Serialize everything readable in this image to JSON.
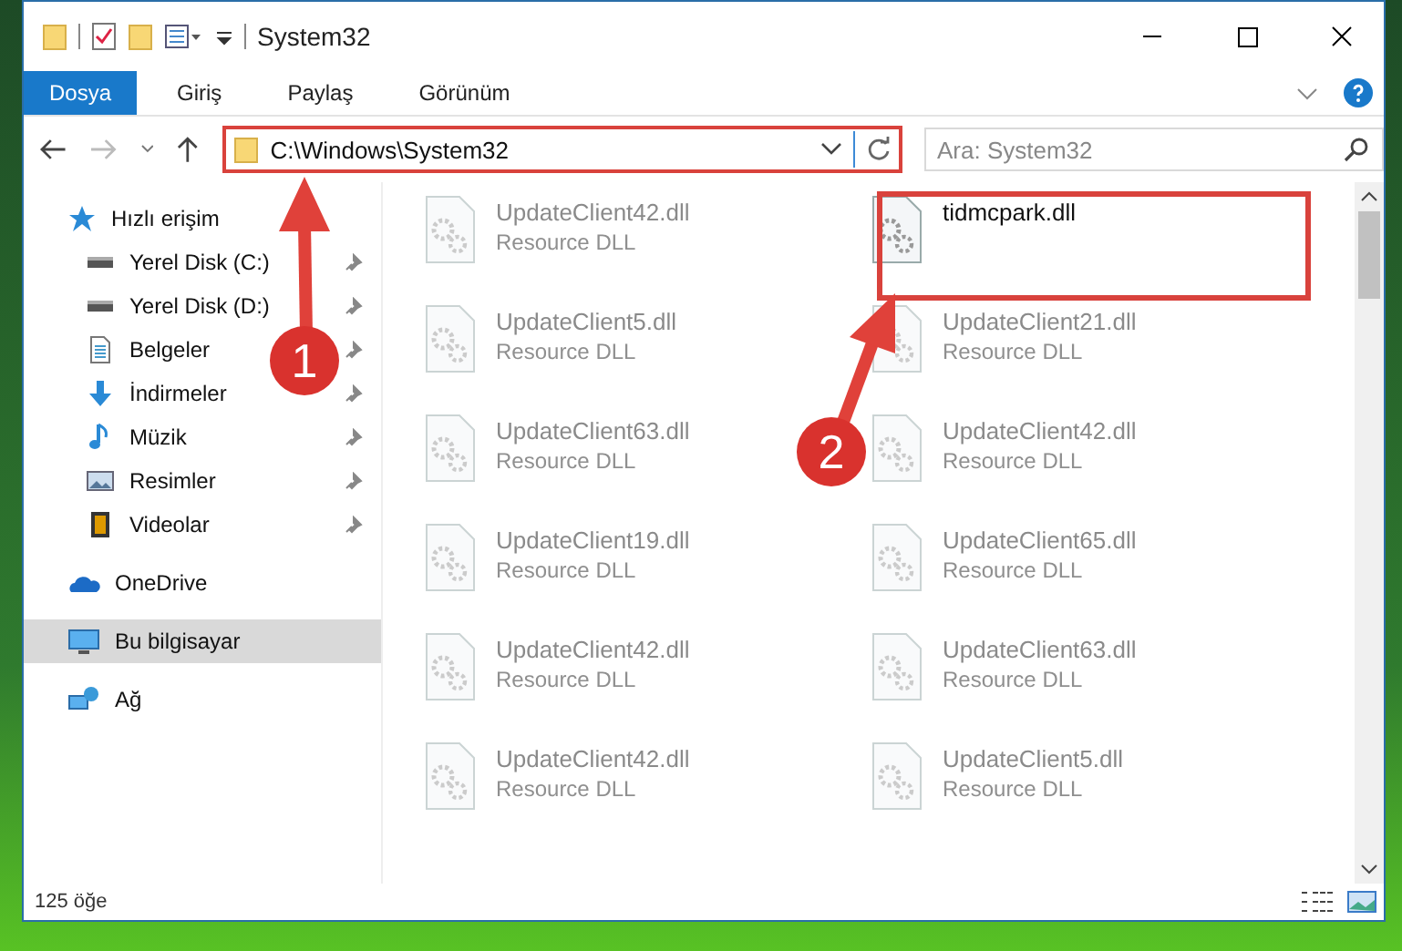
{
  "window": {
    "title": "System32"
  },
  "ribbon_tabs": [
    {
      "label": "Dosya",
      "selected": true
    },
    {
      "label": "Giriş",
      "selected": false
    },
    {
      "label": "Paylaş",
      "selected": false
    },
    {
      "label": "Görünüm",
      "selected": false
    }
  ],
  "address": {
    "path": "C:\\Windows\\System32"
  },
  "search": {
    "placeholder": "Ara: System32"
  },
  "sidebar": {
    "items": [
      {
        "label": "Hızlı erişim",
        "kind": "star",
        "pinned": false,
        "selected": false,
        "group": true
      },
      {
        "label": "Yerel Disk (C:)",
        "kind": "drive",
        "pinned": true,
        "selected": false,
        "group": false
      },
      {
        "label": "Yerel Disk (D:)",
        "kind": "drive",
        "pinned": true,
        "selected": false,
        "group": false
      },
      {
        "label": "Belgeler",
        "kind": "doc",
        "pinned": true,
        "selected": false,
        "group": false
      },
      {
        "label": "İndirmeler",
        "kind": "download",
        "pinned": true,
        "selected": false,
        "group": false
      },
      {
        "label": "Müzik",
        "kind": "music",
        "pinned": true,
        "selected": false,
        "group": false
      },
      {
        "label": "Resimler",
        "kind": "image",
        "pinned": true,
        "selected": false,
        "group": false
      },
      {
        "label": "Videolar",
        "kind": "video",
        "pinned": true,
        "selected": false,
        "group": false
      },
      {
        "label": "OneDrive",
        "kind": "cloud",
        "pinned": false,
        "selected": false,
        "group": true
      },
      {
        "label": "Bu bilgisayar",
        "kind": "pc",
        "pinned": false,
        "selected": true,
        "group": true
      },
      {
        "label": "Ağ",
        "kind": "network",
        "pinned": false,
        "selected": false,
        "group": true
      }
    ]
  },
  "files": [
    {
      "name": "UpdateClient42.dll",
      "type": "Resource DLL",
      "faded": true
    },
    {
      "name": "tidmcpark.dll",
      "faded": false
    },
    {
      "name": "UpdateClient5.dll",
      "type": "Resource DLL",
      "faded": true
    },
    {
      "name": "UpdateClient21.dll",
      "type": "Resource DLL",
      "faded": true
    },
    {
      "name": "UpdateClient63.dll",
      "type": "Resource DLL",
      "faded": true
    },
    {
      "name": "UpdateClient42.dll",
      "type": "Resource DLL",
      "faded": true
    },
    {
      "name": "UpdateClient19.dll",
      "type": "Resource DLL",
      "faded": true
    },
    {
      "name": "UpdateClient65.dll",
      "type": "Resource DLL",
      "faded": true
    },
    {
      "name": "UpdateClient42.dll",
      "type": "Resource DLL",
      "faded": true
    },
    {
      "name": "UpdateClient63.dll",
      "type": "Resource DLL",
      "faded": true
    },
    {
      "name": "UpdateClient42.dll",
      "type": "Resource DLL",
      "faded": true
    },
    {
      "name": "UpdateClient5.dll",
      "type": "Resource DLL",
      "faded": true
    }
  ],
  "annotations": [
    {
      "number": "1"
    },
    {
      "number": "2"
    }
  ],
  "status_bar": {
    "count": "125 öğe"
  }
}
